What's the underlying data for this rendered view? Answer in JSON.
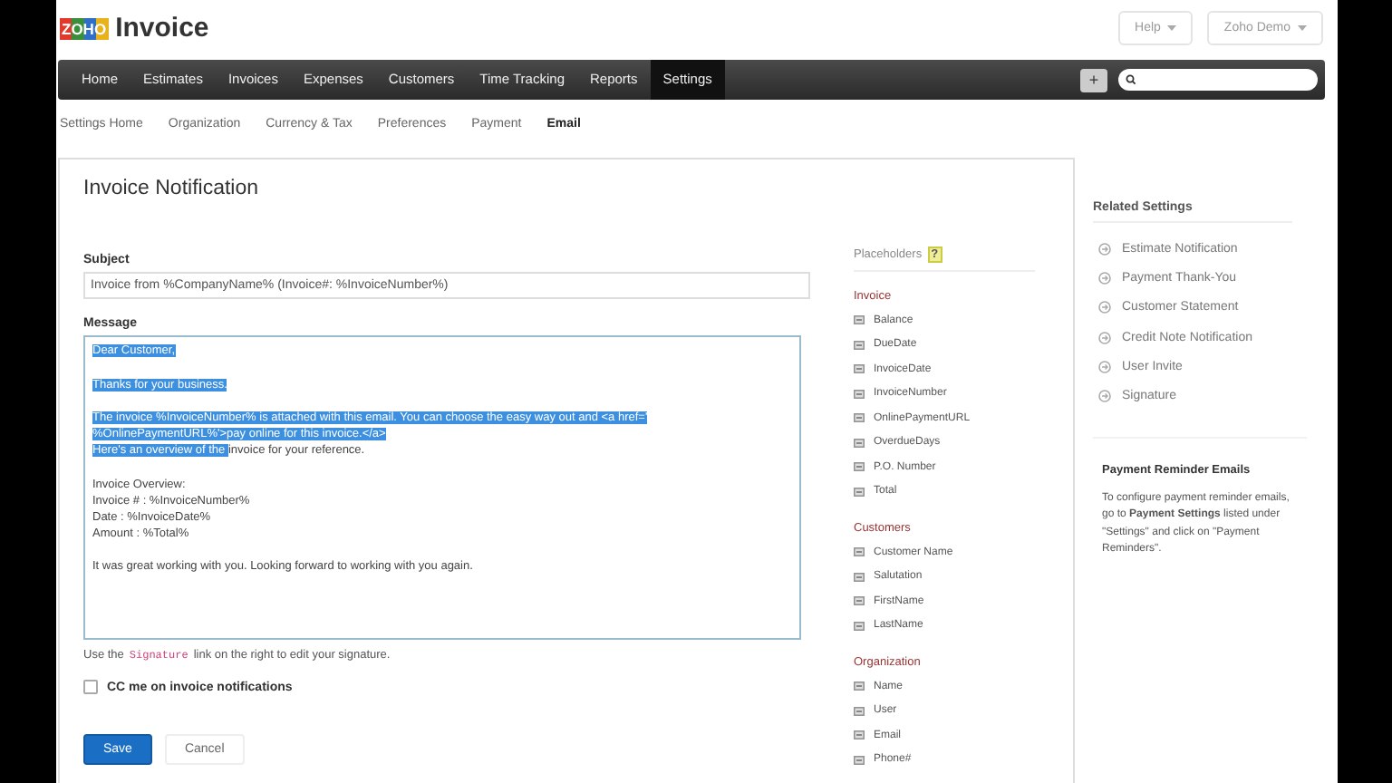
{
  "header": {
    "brand": "ZOHO",
    "app_name": "Invoice",
    "buttons": [
      {
        "label": "Help"
      },
      {
        "label": "Zoho Demo"
      }
    ]
  },
  "nav": {
    "items": [
      {
        "label": "Home",
        "selected": false
      },
      {
        "label": "Estimates",
        "selected": false
      },
      {
        "label": "Invoices",
        "selected": false
      },
      {
        "label": "Expenses",
        "selected": false
      },
      {
        "label": "Customers",
        "selected": false
      },
      {
        "label": "Time Tracking",
        "selected": false
      },
      {
        "label": "Reports",
        "selected": false
      },
      {
        "label": "Settings",
        "selected": true
      }
    ],
    "add_button": "+"
  },
  "subnav": {
    "items": [
      {
        "label": "Settings Home",
        "selected": false
      },
      {
        "label": "Organization",
        "selected": false
      },
      {
        "label": "Currency & Tax",
        "selected": false
      },
      {
        "label": "Preferences",
        "selected": false
      },
      {
        "label": "Payment",
        "selected": false
      },
      {
        "label": "Email",
        "selected": true
      }
    ]
  },
  "form": {
    "title": "Invoice Notification",
    "subject_label": "Subject",
    "subject": "Invoice from %CompanyName% (Invoice#: %InvoiceNumber%)",
    "message_label": "Message",
    "message": [
      [
        [
          {
            "text": "Dear Customer,",
            "selected": true
          }
        ]
      ],
      [
        [
          {
            "text": "Thanks for your business.",
            "selected": true
          }
        ]
      ],
      [
        [
          {
            "text": "The invoice %InvoiceNumber% is attached with this email. You can choose the easy way out and <a href='",
            "selected": true
          }
        ],
        [
          {
            "text": "%OnlinePaymentURL%'>pay online for this invoice.</a>",
            "selected": true
          }
        ],
        [
          {
            "text": "Here's an overview of the ",
            "selected": true
          },
          {
            "text": "invoice for your reference.",
            "selected": false
          }
        ]
      ],
      [
        [
          {
            "text": "Invoice Overview:",
            "selected": false
          }
        ],
        [
          {
            "text": "Invoice # : %InvoiceNumber%",
            "selected": false
          }
        ],
        [
          {
            "text": "Date : %InvoiceDate%",
            "selected": false
          }
        ],
        [
          {
            "text": "Amount : %Total%",
            "selected": false
          }
        ]
      ],
      [
        [
          {
            "text": "It was great working with you. Looking forward to working with you again.",
            "selected": false
          }
        ]
      ]
    ],
    "hint": {
      "before": "Use the",
      "code": "Signature",
      "after": "link on the right to edit your signature."
    },
    "cc": {
      "label": "CC me on invoice notifications",
      "checked": false
    },
    "buttons": [
      {
        "label": "Save",
        "kind": "primary"
      },
      {
        "label": "Cancel",
        "kind": "secondary"
      }
    ]
  },
  "placeholders": {
    "title": "Placeholders",
    "help": "?",
    "groups": [
      {
        "name": "Invoice",
        "items": [
          "Balance",
          "DueDate",
          "InvoiceDate",
          "InvoiceNumber",
          "OnlinePaymentURL",
          "OverdueDays",
          "P.O. Number",
          "Total"
        ]
      },
      {
        "name": "Customers",
        "items": [
          "Customer Name",
          "Salutation",
          "FirstName",
          "LastName"
        ]
      },
      {
        "name": "Organization",
        "items": [
          "Name",
          "User",
          "Email",
          "Phone#"
        ]
      }
    ]
  },
  "related": {
    "title": "Related Settings",
    "items": [
      "Estimate Notification",
      "Payment Thank-You",
      "Customer Statement",
      "Credit Note Notification",
      "User Invite",
      "Signature"
    ],
    "reminder_title": "Payment Reminder Emails",
    "reminder_text": "To configure payment reminder emails, go to **Payment Settings** listed under \"Settings\" and click on \"Payment Reminders\"."
  }
}
